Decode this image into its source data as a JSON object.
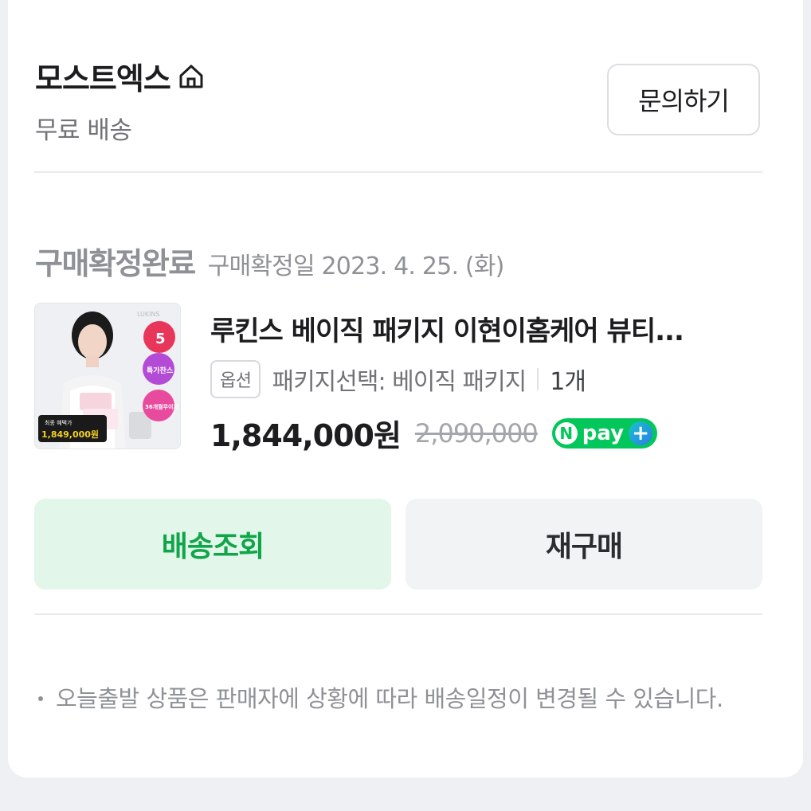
{
  "seller": {
    "name": "모스트엑스",
    "shipping": "무료 배송",
    "inquiry_label": "문의하기"
  },
  "order": {
    "status": "구매확정완료",
    "confirm_date": "구매확정일 2023. 4. 25. (화)"
  },
  "product": {
    "name": "루킨스 베이직 패키지 이현이홈케어 뷰티...",
    "option_badge": "옵션",
    "option_text": "패키지선택: 베이직 패키지",
    "quantity": "1개",
    "price": "1,844,000원",
    "original_price": "2,090,000",
    "npay_label": "pay",
    "npay_n": "N",
    "npay_plus": "+",
    "thumbnail": {
      "brand": "LUKINS",
      "badge_number": "5",
      "badge_special": "특가찬스",
      "badge_months": "36개월무이자",
      "final_price_caption": "최종 혜택가",
      "final_price": "1,849,000원"
    }
  },
  "actions": {
    "track_label": "배송조회",
    "rebuy_label": "재구매"
  },
  "notice": "오늘출발 상품은 판매자에 상황에 따라 배송일정이 변경될 수 있습니다.",
  "colors": {
    "accent_green": "#10a549",
    "track_bg": "#e2f6ea",
    "npay_green": "#03c75a"
  }
}
